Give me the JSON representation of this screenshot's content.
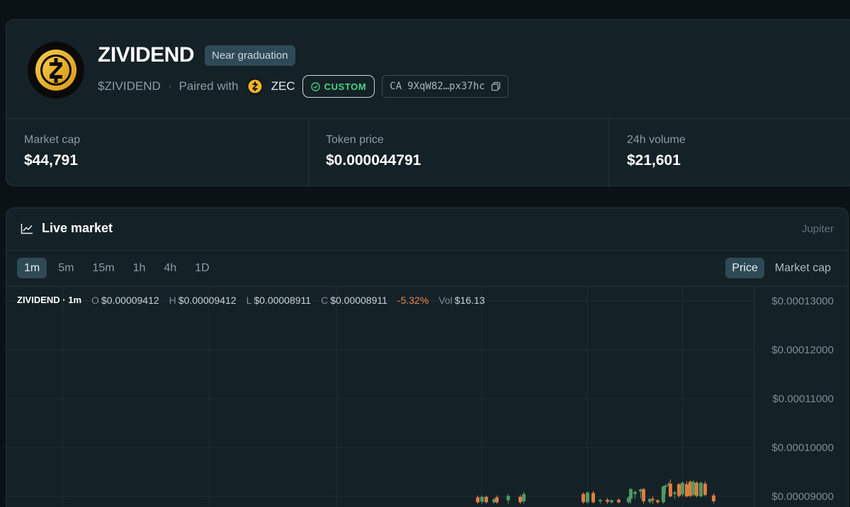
{
  "token": {
    "name": "ZIVIDEND",
    "status_badge": "Near graduation",
    "ticker": "$ZIVIDEND",
    "separator": "·",
    "paired_with_label": "Paired with",
    "pair_symbol": "ZEC",
    "custom_badge": "CUSTOM",
    "ca_label": "CA",
    "ca_value": "9XqW82…px37hc",
    "logo_icon": "zcash-logo-icon"
  },
  "stats": [
    {
      "label": "Market cap",
      "value": "$44,791"
    },
    {
      "label": "Token price",
      "value": "$0.000044791"
    },
    {
      "label": "24h volume",
      "value": "$21,601"
    }
  ],
  "market": {
    "title": "Live market",
    "source": "Jupiter",
    "timeframes": [
      "1m",
      "5m",
      "15m",
      "1h",
      "4h",
      "1D"
    ],
    "active_timeframe": "1m",
    "modes": [
      "Price",
      "Market cap"
    ],
    "active_mode": "Price",
    "ohlc": {
      "symbol": "ZIVIDEND · 1m",
      "o_label": "O",
      "o": "$0.00009412",
      "h_label": "H",
      "h": "$0.00009412",
      "l_label": "L",
      "l": "$0.00008911",
      "c_label": "C",
      "c": "$0.00008911",
      "change": "-5.32%",
      "vol_label": "Vol",
      "vol": "$16.13"
    }
  },
  "colors": {
    "up": "#4c9a63",
    "down": "#e07b3e",
    "custom_green": "#4ad486",
    "accent_bg": "#2e4a56"
  },
  "chart_data": {
    "type": "candlestick",
    "y_tick_labels": [
      "$0.00013000",
      "$0.00012000",
      "$0.00011000",
      "$0.00010000",
      "$0.00009000"
    ],
    "ylim": [
      8.85e-05,
      0.0001315
    ],
    "grid": true,
    "candles": [
      {
        "o": 8.98e-05,
        "h": 9.02e-05,
        "l": 8.85e-05,
        "c": 8.88e-05
      },
      {
        "o": 8.89e-05,
        "h": 9.01e-05,
        "l": 8.85e-05,
        "c": 8.99e-05
      },
      {
        "o": 8.99e-05,
        "h": 9.02e-05,
        "l": 8.85e-05,
        "c": 8.88e-05
      },
      {
        "o": 8.88e-05,
        "h": 8.97e-05,
        "l": 8.85e-05,
        "c": 8.94e-05
      },
      {
        "o": 8.98e-05,
        "h": 9.02e-05,
        "l": 8.85e-05,
        "c": 8.88e-05
      },
      {
        "o": 8.92e-05,
        "h": 9.05e-05,
        "l": 8.85e-05,
        "c": 9.01e-05
      },
      {
        "o": 8.99e-05,
        "h": 9.03e-05,
        "l": 8.85e-05,
        "c": 8.88e-05
      },
      {
        "o": 8.9e-05,
        "h": 9.1e-05,
        "l": 8.85e-05,
        "c": 9.05e-05
      },
      {
        "o": 9.05e-05,
        "h": 9.08e-05,
        "l": 8.85e-05,
        "c": 8.88e-05
      },
      {
        "o": 8.88e-05,
        "h": 9.1e-05,
        "l": 8.85e-05,
        "c": 9.08e-05
      },
      {
        "o": 9.07e-05,
        "h": 9.11e-05,
        "l": 8.85e-05,
        "c": 8.88e-05
      },
      {
        "o": 8.9e-05,
        "h": 8.95e-05,
        "l": 8.85e-05,
        "c": 8.93e-05
      },
      {
        "o": 8.93e-05,
        "h": 8.97e-05,
        "l": 8.85e-05,
        "c": 8.89e-05
      },
      {
        "o": 8.88e-05,
        "h": 8.94e-05,
        "l": 8.85e-05,
        "c": 8.92e-05
      },
      {
        "o": 8.93e-05,
        "h": 8.96e-05,
        "l": 8.85e-05,
        "c": 8.88e-05
      },
      {
        "o": 8.88e-05,
        "h": 9e-05,
        "l": 8.85e-05,
        "c": 8.97e-05
      },
      {
        "o": 8.95e-05,
        "h": 9.17e-05,
        "l": 8.85e-05,
        "c": 9.15e-05
      },
      {
        "o": 9.05e-05,
        "h": 9.12e-05,
        "l": 8.95e-05,
        "c": 9.09e-05
      },
      {
        "o": 9.1e-05,
        "h": 9.16e-05,
        "l": 8.96e-05,
        "c": 9.14e-05
      },
      {
        "o": 9.15e-05,
        "h": 9.17e-05,
        "l": 8.85e-05,
        "c": 8.9e-05
      },
      {
        "o": 8.89e-05,
        "h": 8.96e-05,
        "l": 8.85e-05,
        "c": 8.95e-05
      },
      {
        "o": 8.95e-05,
        "h": 9e-05,
        "l": 8.85e-05,
        "c": 8.92e-05
      },
      {
        "o": 8.92e-05,
        "h": 8.94e-05,
        "l": 8.85e-05,
        "c": 8.88e-05
      },
      {
        "o": 8.88e-05,
        "h": 9.22e-05,
        "l": 8.85e-05,
        "c": 9.2e-05
      },
      {
        "o": 9.19e-05,
        "h": 9.25e-05,
        "l": 9.05e-05,
        "c": 9.22e-05
      },
      {
        "o": 9.22e-05,
        "h": 9.3e-05,
        "l": 9.1e-05,
        "c": 9.26e-05
      },
      {
        "o": 9.26e-05,
        "h": 9.35e-05,
        "l": 8.98e-05,
        "c": 9e-05
      },
      {
        "o": 9.05e-05,
        "h": 9.12e-05,
        "l": 8.95e-05,
        "c": 9.08e-05
      },
      {
        "o": 9.25e-05,
        "h": 9.27e-05,
        "l": 8.98e-05,
        "c": 9.01e-05
      },
      {
        "o": 9.04e-05,
        "h": 9.3e-05,
        "l": 9e-05,
        "c": 9.28e-05
      },
      {
        "o": 9.25e-05,
        "h": 9.31e-05,
        "l": 8.98e-05,
        "c": 9e-05
      },
      {
        "o": 9.3e-05,
        "h": 9.33e-05,
        "l": 8.98e-05,
        "c": 9.01e-05
      },
      {
        "o": 9.03e-05,
        "h": 9.33e-05,
        "l": 9e-05,
        "c": 9.3e-05
      },
      {
        "o": 9.28e-05,
        "h": 9.31e-05,
        "l": 8.98e-05,
        "c": 9.01e-05
      },
      {
        "o": 9e-05,
        "h": 9.3e-05,
        "l": 8.98e-05,
        "c": 9.28e-05
      },
      {
        "o": 9.26e-05,
        "h": 9.31e-05,
        "l": 9e-05,
        "c": 9.03e-05
      },
      {
        "o": 9.02e-05,
        "h": 9.06e-05,
        "l": 8.85e-05,
        "c": 8.9e-05
      }
    ]
  }
}
